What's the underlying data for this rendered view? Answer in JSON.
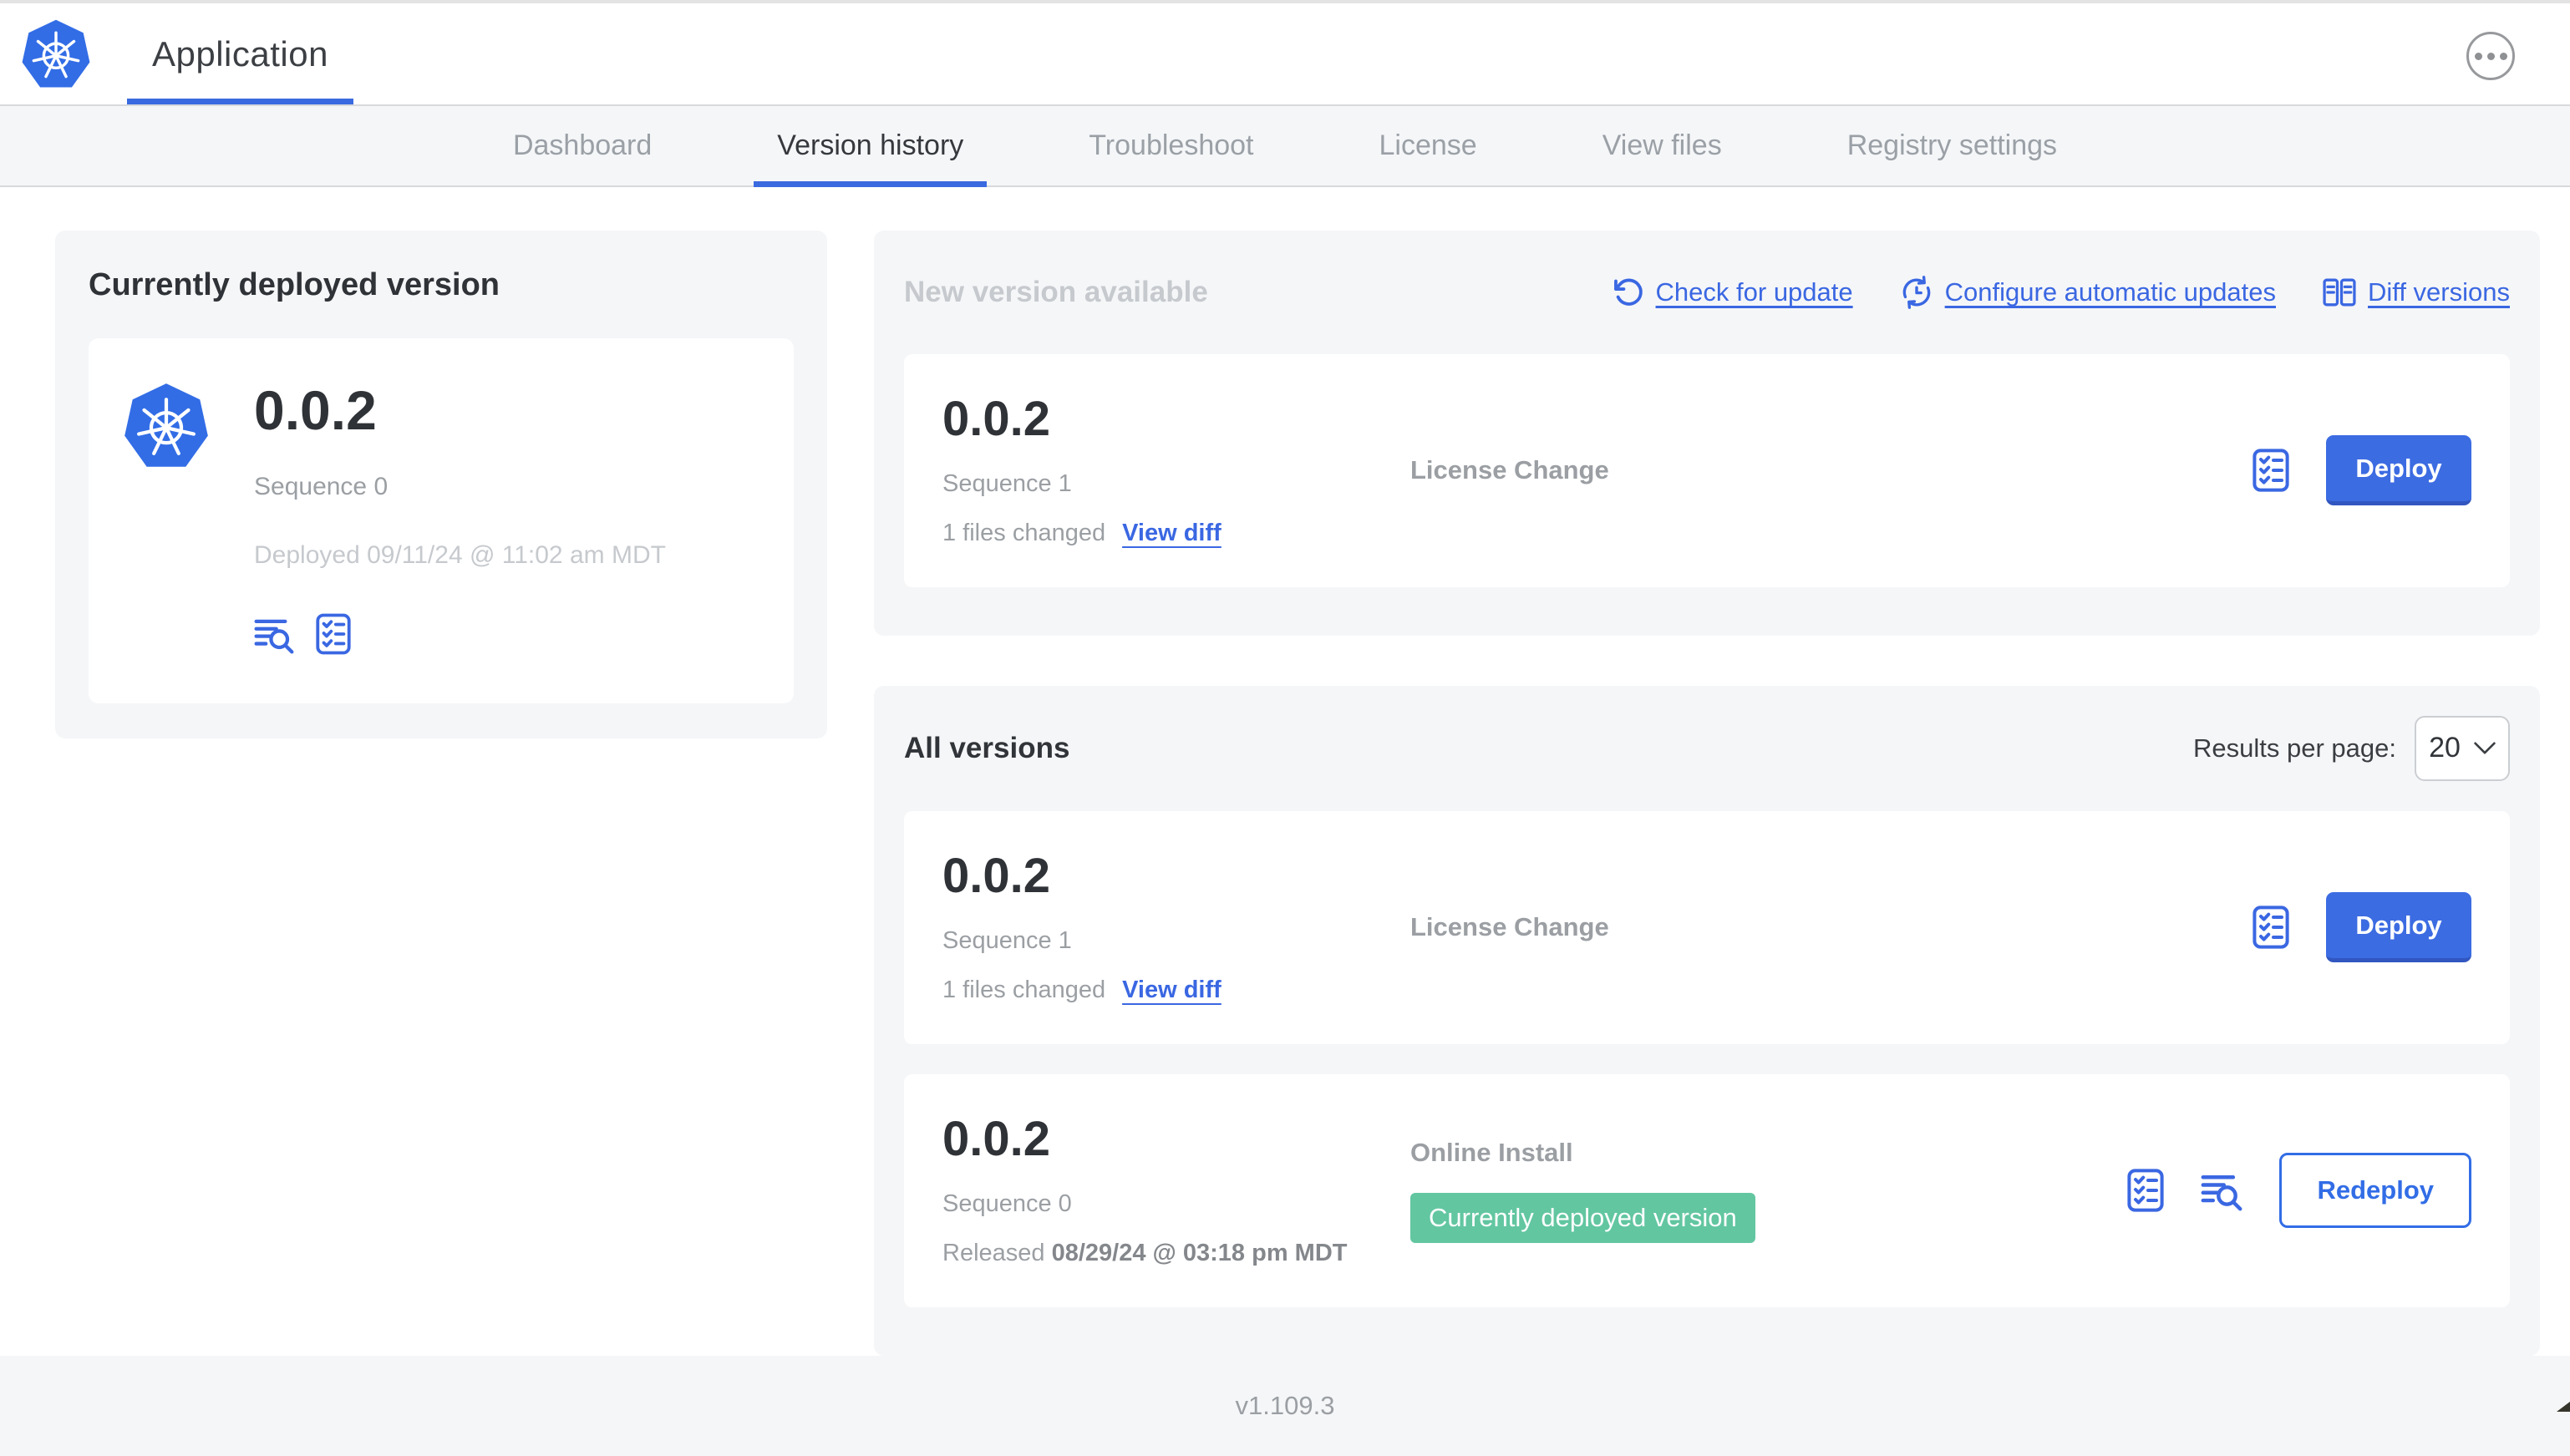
{
  "header": {
    "title": "Application"
  },
  "nav": {
    "tabs": [
      "Dashboard",
      "Version history",
      "Troubleshoot",
      "License",
      "View files",
      "Registry settings"
    ],
    "active_tab": "Version history"
  },
  "current": {
    "heading": "Currently deployed version",
    "version": "0.0.2",
    "sequence": "Sequence 0",
    "deployed": "Deployed 09/11/24 @ 11:02 am MDT"
  },
  "new_version": {
    "heading": "New version available",
    "links": {
      "check": "Check for update",
      "auto": "Configure automatic updates",
      "diff": "Diff versions"
    },
    "row": {
      "version": "0.0.2",
      "sequence": "Sequence 1",
      "files_changed": "1 files changed",
      "view_diff": "View diff",
      "source": "License Change",
      "action": "Deploy"
    }
  },
  "all_versions": {
    "heading": "All versions",
    "results_label": "Results per page:",
    "results_value": "20",
    "rows": [
      {
        "version": "0.0.2",
        "sequence": "Sequence 1",
        "files_changed": "1 files changed",
        "view_diff": "View diff",
        "source": "License Change",
        "action": "Deploy"
      },
      {
        "version": "0.0.2",
        "sequence": "Sequence 0",
        "released_label": "Released",
        "released_date": "08/29/24 @ 03:18 pm MDT",
        "source": "Online Install",
        "badge": "Currently deployed version",
        "action": "Redeploy"
      }
    ]
  },
  "footer": {
    "app_version": "v1.109.3"
  },
  "colors": {
    "primary_blue": "#326de6",
    "link_blue": "#3a67e2",
    "badge_green": "#62c6a1",
    "muted_gray": "#9b9fa3",
    "faint_gray": "#c6c9cd",
    "panel_gray": "#f5f6f8"
  }
}
